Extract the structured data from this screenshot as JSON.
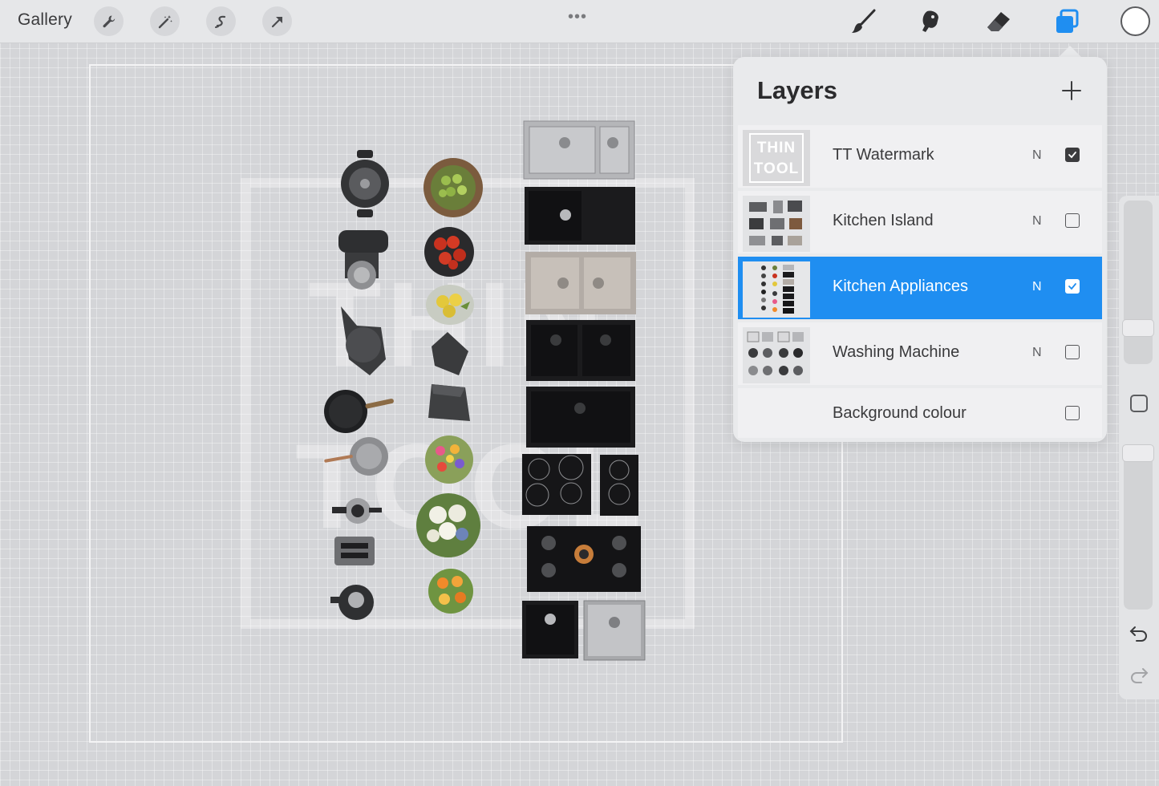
{
  "toolbar": {
    "gallery_label": "Gallery",
    "left_tools": [
      "wrench-icon",
      "magic-wand-icon",
      "selection-s-icon",
      "transform-arrow-icon"
    ],
    "more_label": "•••",
    "right_tools": [
      "brush-icon",
      "smudge-icon",
      "eraser-icon",
      "layers-icon"
    ],
    "layers_active_color": "#1f8ef1",
    "current_color": "#ffffff"
  },
  "canvas": {
    "watermark_line1": "THIN",
    "watermark_line2": "TOOL"
  },
  "layers": {
    "title": "Layers",
    "add_icon": "plus-icon",
    "items": [
      {
        "name": "TT Watermark",
        "mode": "N",
        "visible": true,
        "active": false,
        "thumb_text_1": "THIN",
        "thumb_text_2": "TOOL"
      },
      {
        "name": "Kitchen Island",
        "mode": "N",
        "visible": false,
        "active": false
      },
      {
        "name": "Kitchen Appliances",
        "mode": "N",
        "visible": true,
        "active": true
      },
      {
        "name": "Washing Machine",
        "mode": "N",
        "visible": false,
        "active": false
      },
      {
        "name": "Background colour",
        "mode": "",
        "visible": false,
        "active": false
      }
    ]
  },
  "sidebar": {
    "undo_icon": "undo-icon",
    "redo_icon": "redo-icon",
    "modify_icon": "square-modify-icon"
  }
}
